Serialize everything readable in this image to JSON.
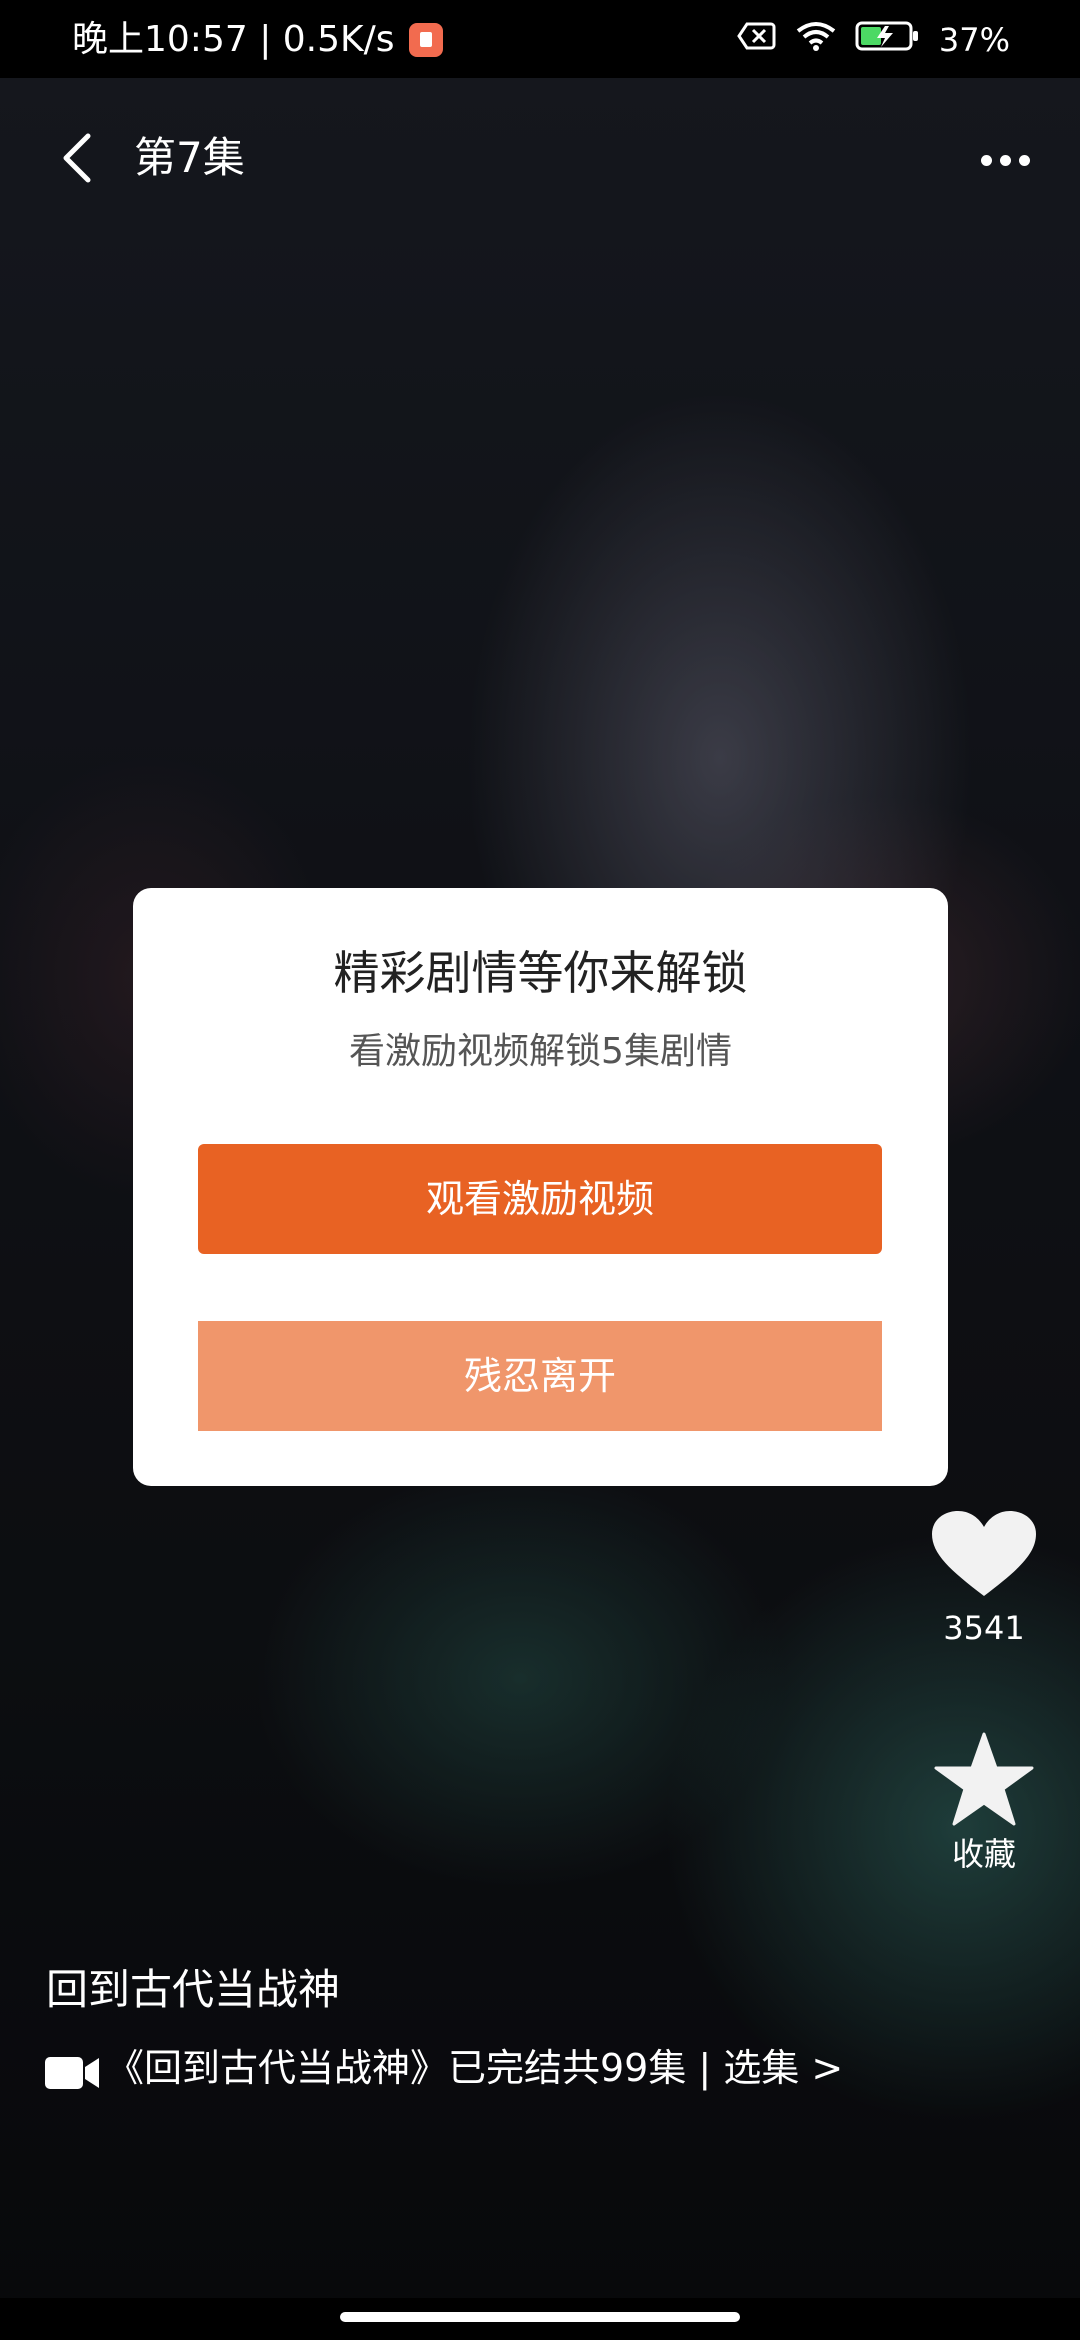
{
  "status_bar": {
    "time_and_speed": "晚上10:57 | 0.5K/s",
    "battery": "37%"
  },
  "header": {
    "episode_title": "第7集"
  },
  "dialog": {
    "title": "精彩剧情等你来解锁",
    "subtitle": "看激励视频解锁5集剧情",
    "watch_button": "观看激励视频",
    "leave_button": "残忍离开"
  },
  "actions": {
    "like_count": "3541",
    "favorite_label": "收藏"
  },
  "show": {
    "title": "回到古代当战神",
    "meta": "《回到古代当战神》已完结共99集 | 选集 >"
  },
  "colors": {
    "primary_button": "#e86223",
    "secondary_button": "#f0966b"
  },
  "icons": {
    "back": "chevron-left-icon",
    "more": "more-dots-icon",
    "like": "heart-icon",
    "favorite": "star-icon",
    "series": "video-camera-icon"
  }
}
